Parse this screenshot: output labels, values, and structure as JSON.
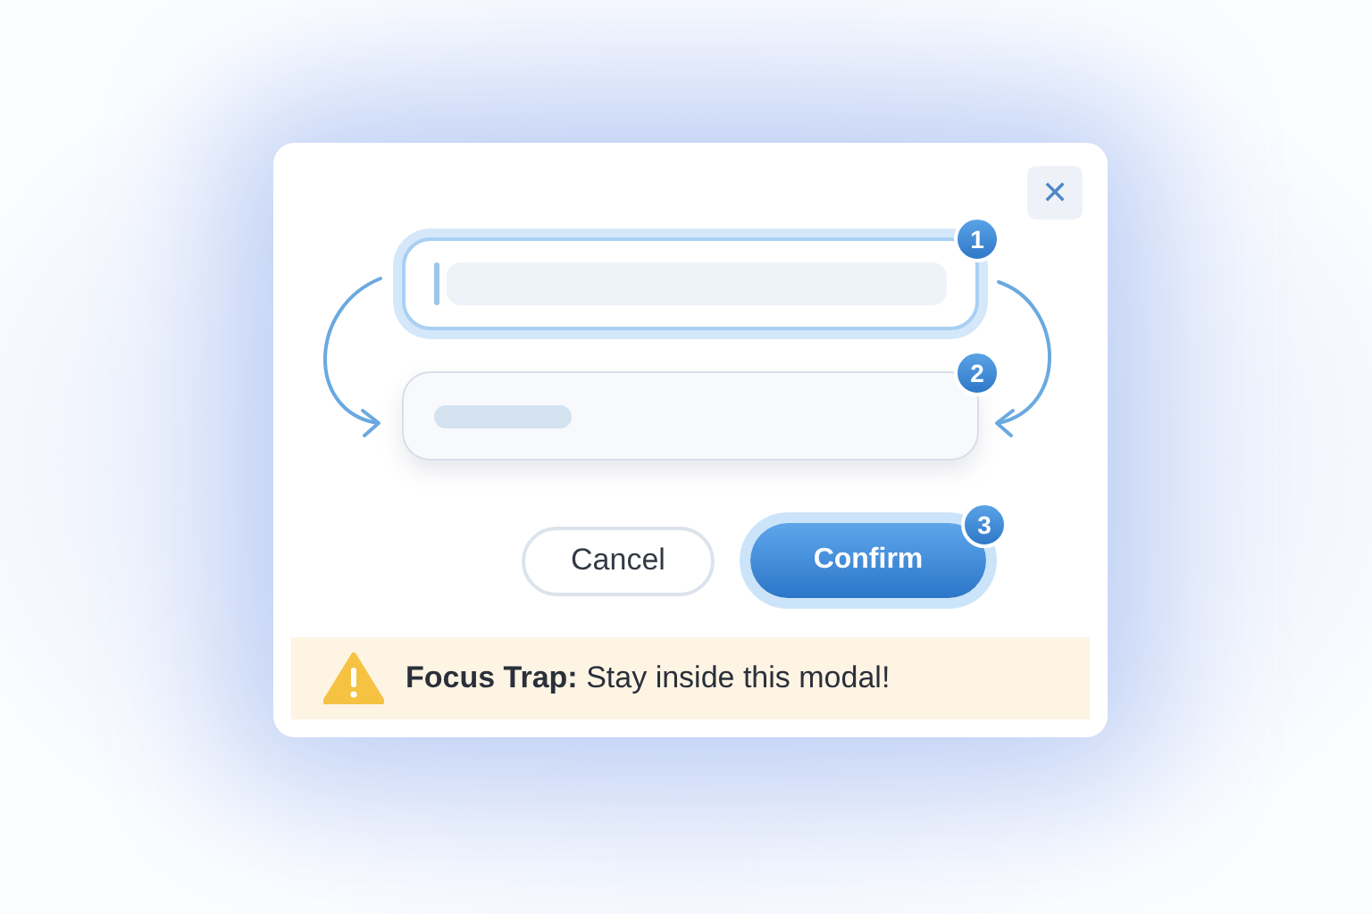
{
  "dialog": {
    "close_label": "✕"
  },
  "fields": [
    {
      "badge": "1",
      "focused": true,
      "kind": "caret"
    },
    {
      "badge": "2",
      "focused": false,
      "kind": "filled"
    }
  ],
  "buttons": [
    {
      "label": "Cancel",
      "kind": "secondary",
      "focused": false
    },
    {
      "label": "Confirm",
      "kind": "primary",
      "badge": "3",
      "focused": true
    }
  ],
  "alert": {
    "text": "**Focus Trap:** Stay inside this modal!"
  }
}
